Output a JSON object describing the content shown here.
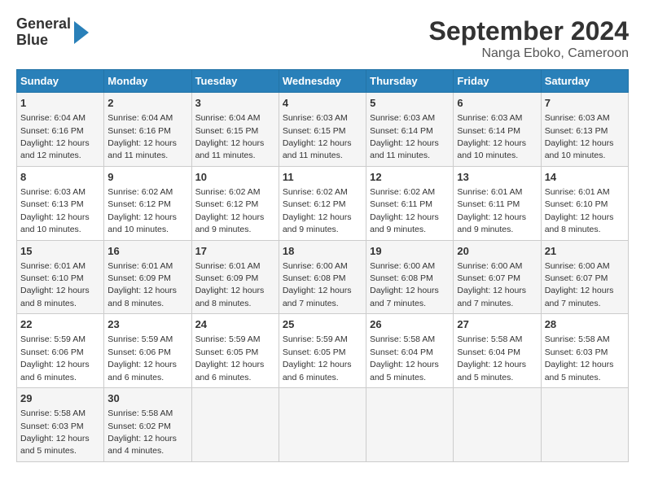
{
  "header": {
    "logo_line1": "General",
    "logo_line2": "Blue",
    "title": "September 2024",
    "subtitle": "Nanga Eboko, Cameroon"
  },
  "weekdays": [
    "Sunday",
    "Monday",
    "Tuesday",
    "Wednesday",
    "Thursday",
    "Friday",
    "Saturday"
  ],
  "weeks": [
    [
      {
        "day": "1",
        "sunrise": "Sunrise: 6:04 AM",
        "sunset": "Sunset: 6:16 PM",
        "daylight": "Daylight: 12 hours and 12 minutes."
      },
      {
        "day": "2",
        "sunrise": "Sunrise: 6:04 AM",
        "sunset": "Sunset: 6:16 PM",
        "daylight": "Daylight: 12 hours and 11 minutes."
      },
      {
        "day": "3",
        "sunrise": "Sunrise: 6:04 AM",
        "sunset": "Sunset: 6:15 PM",
        "daylight": "Daylight: 12 hours and 11 minutes."
      },
      {
        "day": "4",
        "sunrise": "Sunrise: 6:03 AM",
        "sunset": "Sunset: 6:15 PM",
        "daylight": "Daylight: 12 hours and 11 minutes."
      },
      {
        "day": "5",
        "sunrise": "Sunrise: 6:03 AM",
        "sunset": "Sunset: 6:14 PM",
        "daylight": "Daylight: 12 hours and 11 minutes."
      },
      {
        "day": "6",
        "sunrise": "Sunrise: 6:03 AM",
        "sunset": "Sunset: 6:14 PM",
        "daylight": "Daylight: 12 hours and 10 minutes."
      },
      {
        "day": "7",
        "sunrise": "Sunrise: 6:03 AM",
        "sunset": "Sunset: 6:13 PM",
        "daylight": "Daylight: 12 hours and 10 minutes."
      }
    ],
    [
      {
        "day": "8",
        "sunrise": "Sunrise: 6:03 AM",
        "sunset": "Sunset: 6:13 PM",
        "daylight": "Daylight: 12 hours and 10 minutes."
      },
      {
        "day": "9",
        "sunrise": "Sunrise: 6:02 AM",
        "sunset": "Sunset: 6:12 PM",
        "daylight": "Daylight: 12 hours and 10 minutes."
      },
      {
        "day": "10",
        "sunrise": "Sunrise: 6:02 AM",
        "sunset": "Sunset: 6:12 PM",
        "daylight": "Daylight: 12 hours and 9 minutes."
      },
      {
        "day": "11",
        "sunrise": "Sunrise: 6:02 AM",
        "sunset": "Sunset: 6:12 PM",
        "daylight": "Daylight: 12 hours and 9 minutes."
      },
      {
        "day": "12",
        "sunrise": "Sunrise: 6:02 AM",
        "sunset": "Sunset: 6:11 PM",
        "daylight": "Daylight: 12 hours and 9 minutes."
      },
      {
        "day": "13",
        "sunrise": "Sunrise: 6:01 AM",
        "sunset": "Sunset: 6:11 PM",
        "daylight": "Daylight: 12 hours and 9 minutes."
      },
      {
        "day": "14",
        "sunrise": "Sunrise: 6:01 AM",
        "sunset": "Sunset: 6:10 PM",
        "daylight": "Daylight: 12 hours and 8 minutes."
      }
    ],
    [
      {
        "day": "15",
        "sunrise": "Sunrise: 6:01 AM",
        "sunset": "Sunset: 6:10 PM",
        "daylight": "Daylight: 12 hours and 8 minutes."
      },
      {
        "day": "16",
        "sunrise": "Sunrise: 6:01 AM",
        "sunset": "Sunset: 6:09 PM",
        "daylight": "Daylight: 12 hours and 8 minutes."
      },
      {
        "day": "17",
        "sunrise": "Sunrise: 6:01 AM",
        "sunset": "Sunset: 6:09 PM",
        "daylight": "Daylight: 12 hours and 8 minutes."
      },
      {
        "day": "18",
        "sunrise": "Sunrise: 6:00 AM",
        "sunset": "Sunset: 6:08 PM",
        "daylight": "Daylight: 12 hours and 7 minutes."
      },
      {
        "day": "19",
        "sunrise": "Sunrise: 6:00 AM",
        "sunset": "Sunset: 6:08 PM",
        "daylight": "Daylight: 12 hours and 7 minutes."
      },
      {
        "day": "20",
        "sunrise": "Sunrise: 6:00 AM",
        "sunset": "Sunset: 6:07 PM",
        "daylight": "Daylight: 12 hours and 7 minutes."
      },
      {
        "day": "21",
        "sunrise": "Sunrise: 6:00 AM",
        "sunset": "Sunset: 6:07 PM",
        "daylight": "Daylight: 12 hours and 7 minutes."
      }
    ],
    [
      {
        "day": "22",
        "sunrise": "Sunrise: 5:59 AM",
        "sunset": "Sunset: 6:06 PM",
        "daylight": "Daylight: 12 hours and 6 minutes."
      },
      {
        "day": "23",
        "sunrise": "Sunrise: 5:59 AM",
        "sunset": "Sunset: 6:06 PM",
        "daylight": "Daylight: 12 hours and 6 minutes."
      },
      {
        "day": "24",
        "sunrise": "Sunrise: 5:59 AM",
        "sunset": "Sunset: 6:05 PM",
        "daylight": "Daylight: 12 hours and 6 minutes."
      },
      {
        "day": "25",
        "sunrise": "Sunrise: 5:59 AM",
        "sunset": "Sunset: 6:05 PM",
        "daylight": "Daylight: 12 hours and 6 minutes."
      },
      {
        "day": "26",
        "sunrise": "Sunrise: 5:58 AM",
        "sunset": "Sunset: 6:04 PM",
        "daylight": "Daylight: 12 hours and 5 minutes."
      },
      {
        "day": "27",
        "sunrise": "Sunrise: 5:58 AM",
        "sunset": "Sunset: 6:04 PM",
        "daylight": "Daylight: 12 hours and 5 minutes."
      },
      {
        "day": "28",
        "sunrise": "Sunrise: 5:58 AM",
        "sunset": "Sunset: 6:03 PM",
        "daylight": "Daylight: 12 hours and 5 minutes."
      }
    ],
    [
      {
        "day": "29",
        "sunrise": "Sunrise: 5:58 AM",
        "sunset": "Sunset: 6:03 PM",
        "daylight": "Daylight: 12 hours and 5 minutes."
      },
      {
        "day": "30",
        "sunrise": "Sunrise: 5:58 AM",
        "sunset": "Sunset: 6:02 PM",
        "daylight": "Daylight: 12 hours and 4 minutes."
      },
      null,
      null,
      null,
      null,
      null
    ]
  ]
}
